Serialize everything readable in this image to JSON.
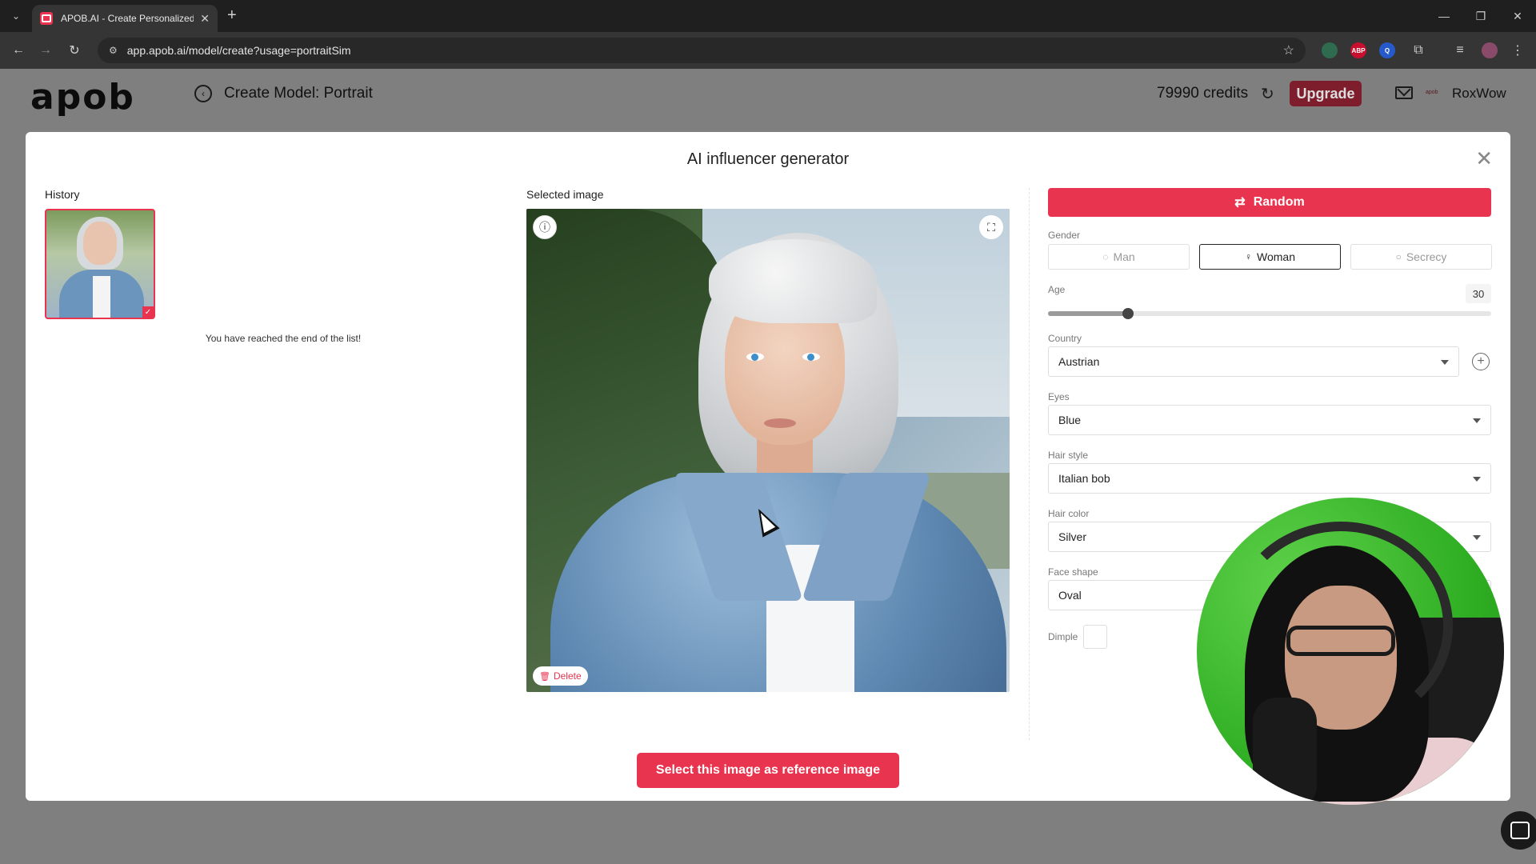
{
  "browser": {
    "tab_title": "APOB.AI - Create Personalized A",
    "url": "app.apob.ai/model/create?usage=portraitSim",
    "extensions": [
      "ABP",
      "Q"
    ]
  },
  "header": {
    "logo": "apob",
    "page_title": "Create Model: Portrait",
    "credits": "79990 credits",
    "upgrade_label": "Upgrade",
    "user_mini": "apob",
    "username": "RoxWow"
  },
  "modal": {
    "title": "AI influencer generator",
    "history_label": "History",
    "end_of_list": "You have reached the end of the list!",
    "selected_label": "Selected image",
    "delete_label": "Delete",
    "select_button": "Select this image as reference image"
  },
  "form": {
    "random_label": "Random",
    "gender": {
      "label": "Gender",
      "options": [
        "Man",
        "Woman",
        "Secrecy"
      ],
      "selected": "Woman"
    },
    "age": {
      "label": "Age",
      "value": "30",
      "min": 0,
      "max": 100,
      "level": 0.18
    },
    "country": {
      "label": "Country",
      "value": "Austrian"
    },
    "eyes": {
      "label": "Eyes",
      "value": "Blue"
    },
    "hair_style": {
      "label": "Hair style",
      "value": "Italian bob"
    },
    "hair_color": {
      "label": "Hair color",
      "value": "Silver"
    },
    "face_shape": {
      "label": "Face shape",
      "value": "Oval"
    },
    "dimple": {
      "label": "Dimple"
    }
  },
  "colors": {
    "accent": "#e8344e",
    "upgrade_dim": "#7e1d2c",
    "overlay": "#7f7f7f"
  }
}
